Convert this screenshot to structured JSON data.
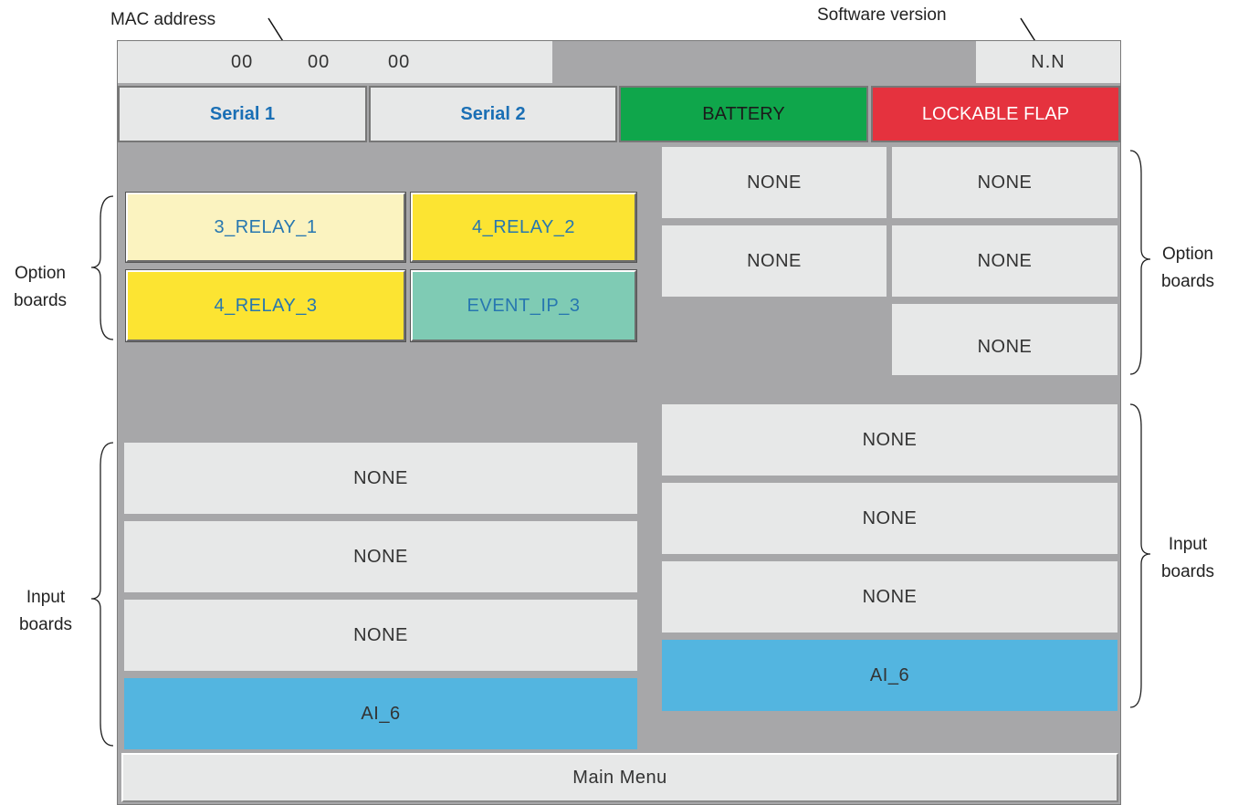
{
  "annotations": {
    "mac_address": "MAC address",
    "software_version": "Software version",
    "option_boards_left": [
      "Option",
      "boards"
    ],
    "option_boards_right": [
      "Option",
      "boards"
    ],
    "input_boards_left": [
      "Input",
      "boards"
    ],
    "input_boards_right": [
      "Input",
      "boards"
    ]
  },
  "header": {
    "mac_segments": [
      "00",
      "00",
      "00"
    ],
    "software_version": "N.N"
  },
  "top_buttons": {
    "serial1": "Serial 1",
    "serial2": "Serial 2",
    "battery": "BATTERY",
    "lockable_flap": "LOCKABLE FLAP"
  },
  "option_boards_left": [
    "3_RELAY_1",
    "4_RELAY_2",
    "4_RELAY_3",
    "EVENT_IP_3"
  ],
  "option_boards_right": [
    "NONE",
    "NONE",
    "NONE",
    "NONE",
    "NONE"
  ],
  "input_boards_left": [
    "NONE",
    "NONE",
    "NONE",
    "AI_6"
  ],
  "input_boards_right": [
    "NONE",
    "NONE",
    "NONE",
    "AI_6"
  ],
  "footer": {
    "main_menu": "Main Menu"
  },
  "colors": {
    "screen_bg": "#a7a7a9",
    "panel": "#e7e8e8",
    "battery": "#0fa64b",
    "lockable_flap": "#e5323e",
    "serial_text": "#1a6fb5",
    "relay_light": "#fbf3c0",
    "relay_yellow": "#fce432",
    "event_teal": "#7fcbb4",
    "ai_blue": "#53b5e0"
  }
}
